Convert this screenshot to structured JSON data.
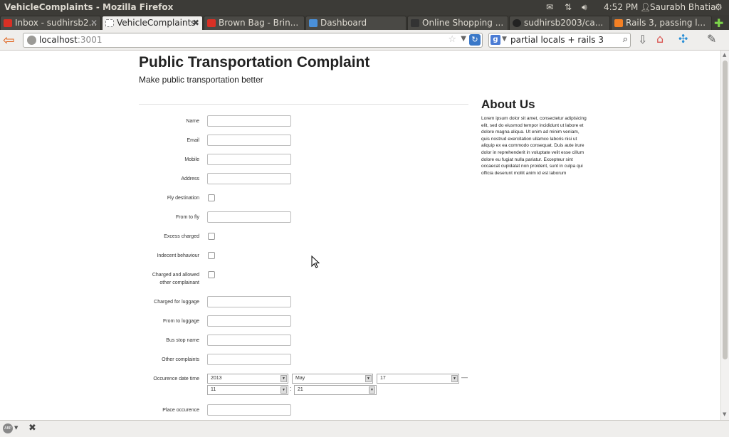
{
  "window": {
    "title": "VehicleComplaints - Mozilla Firefox",
    "clock": "4:52 PM",
    "user": "Saurabh Bhatia"
  },
  "tabs": [
    {
      "label": "Inbox - sudhirsb2...",
      "icon": "gmail-icon",
      "color": "#d93025"
    },
    {
      "label": "VehicleComplaints",
      "icon": "blank-page-icon",
      "color": "#ffffff",
      "active": true
    },
    {
      "label": "Brown Bag - Brin...",
      "icon": "gmail-icon",
      "color": "#d93025"
    },
    {
      "label": "Dashboard",
      "icon": "dashboard-icon",
      "color": "#4a90d9"
    },
    {
      "label": "Online Shopping ...",
      "icon": "tag-icon",
      "color": "#333333"
    },
    {
      "label": "sudhirsb2003/ca...",
      "icon": "github-icon",
      "color": "#222222"
    },
    {
      "label": "Rails 3, passing l...",
      "icon": "stackoverflow-icon",
      "color": "#f48024"
    }
  ],
  "address": {
    "host": "localhost",
    "port": ":3001"
  },
  "search": {
    "value": "partial locals + rails 3"
  },
  "page": {
    "title": "Public Transportation Complaint",
    "subtitle": "Make public transportation better",
    "about_title": "About Us",
    "about_text": "Lorem ipsum dolor sit amet, consectetur adipisicing elit, sed do eiusmod tempor incididunt ut labore et dolore magna aliqua. Ut enim ad minim veniam, quis nostrud exercitation ullamco laboris nisi ut aliquip ex ea commodo consequat. Duis aute irure dolor in reprehenderit in voluptate velit esse cillum dolore eu fugiat nulla pariatur. Excepteur sint occaecat cupidatat non proident, sunt in culpa qui officia deserunt mollit anim id est laborum"
  },
  "form": {
    "name": "Name",
    "email": "Email",
    "mobile": "Mobile",
    "address": "Address",
    "fly_destination": "Fly destination",
    "from_to_fly": "From to fly",
    "excess_charged": "Excess charged",
    "indecent_behaviour": "Indecent behaviour",
    "charged_allowed_1": "Charged and allowed",
    "charged_allowed_2": "other complainant",
    "charged_luggage": "Charged for luggage",
    "from_luggage": "From to luggage",
    "bus_stop": "Bus stop name",
    "other_complaints": "Other complaints",
    "occurence": "Occurence date time",
    "place": "Place occurence",
    "year": "2013",
    "month": "May",
    "day": "17",
    "hour": "11",
    "minute": "21",
    "dash": "—",
    "colon": ":"
  },
  "colors": {
    "accent_back": "#e1651f",
    "reload": "#3a78c8",
    "topbar": "#3c3b37"
  }
}
